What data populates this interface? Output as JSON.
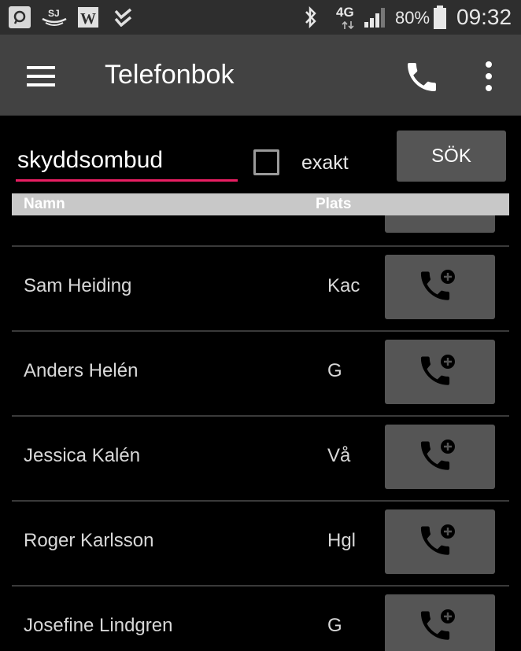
{
  "status_bar": {
    "network_type": "4G",
    "battery": "80%",
    "time": "09:32"
  },
  "app_bar": {
    "title": "Telefonbok"
  },
  "search": {
    "query": "skyddsombud",
    "exact_label": "exakt",
    "exact_checked": false,
    "button_label": "SÖK"
  },
  "list": {
    "columns": {
      "name": "Namn",
      "place": "Plats"
    },
    "rows": [
      {
        "name": "Sam Heiding",
        "place": "Kac"
      },
      {
        "name": "Anders Helén",
        "place": "G"
      },
      {
        "name": "Jessica Kalén",
        "place": "Vå"
      },
      {
        "name": "Roger Karlsson",
        "place": "Hgl"
      },
      {
        "name": "Josefine Lindgren",
        "place": "G"
      }
    ]
  },
  "colors": {
    "accent": "#e91e63",
    "appbar": "#424242",
    "statusbar": "#2e2e2e",
    "button": "#555555",
    "header": "#c8c8c8"
  },
  "icons": {
    "menu": "menu-icon",
    "phone": "phone-icon",
    "overflow": "more-vert-icon",
    "add_call": "phone-plus-icon"
  }
}
